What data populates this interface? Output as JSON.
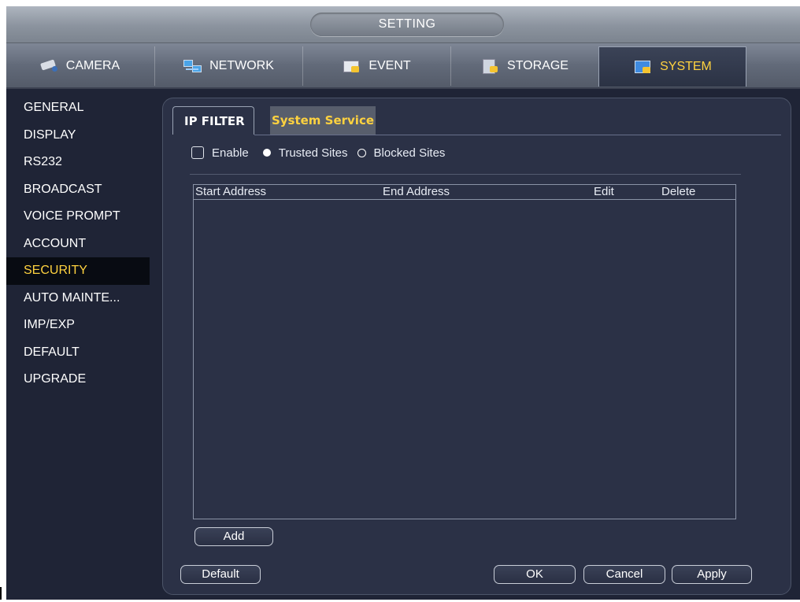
{
  "window": {
    "title": "SETTING"
  },
  "main_tabs": [
    {
      "label": "CAMERA",
      "icon": "camera-icon"
    },
    {
      "label": "NETWORK",
      "icon": "network-icon"
    },
    {
      "label": "EVENT",
      "icon": "event-icon"
    },
    {
      "label": "STORAGE",
      "icon": "storage-icon"
    },
    {
      "label": "SYSTEM",
      "icon": "system-icon",
      "active": true
    }
  ],
  "sidebar": {
    "items": [
      {
        "label": "GENERAL"
      },
      {
        "label": "DISPLAY"
      },
      {
        "label": "RS232"
      },
      {
        "label": "BROADCAST"
      },
      {
        "label": "VOICE PROMPT"
      },
      {
        "label": "ACCOUNT"
      },
      {
        "label": "SECURITY",
        "active": true
      },
      {
        "label": "AUTO MAINTE..."
      },
      {
        "label": "IMP/EXP"
      },
      {
        "label": "DEFAULT"
      },
      {
        "label": "UPGRADE"
      }
    ]
  },
  "sub_tabs": [
    {
      "label": "IP FILTER",
      "active": true
    },
    {
      "label": "System Service"
    }
  ],
  "options": {
    "enable_label": "Enable",
    "enable_checked": false,
    "trusted_label": "Trusted Sites",
    "blocked_label": "Blocked Sites",
    "selected": "Trusted Sites"
  },
  "table": {
    "columns": [
      "Start Address",
      "End Address",
      "Edit",
      "Delete"
    ],
    "rows": []
  },
  "buttons": {
    "add": "Add",
    "default": "Default",
    "ok": "OK",
    "cancel": "Cancel",
    "apply": "Apply"
  },
  "colors": {
    "accent": "#ffd23f",
    "background": "#1f2436",
    "panel": "#2b3146"
  }
}
